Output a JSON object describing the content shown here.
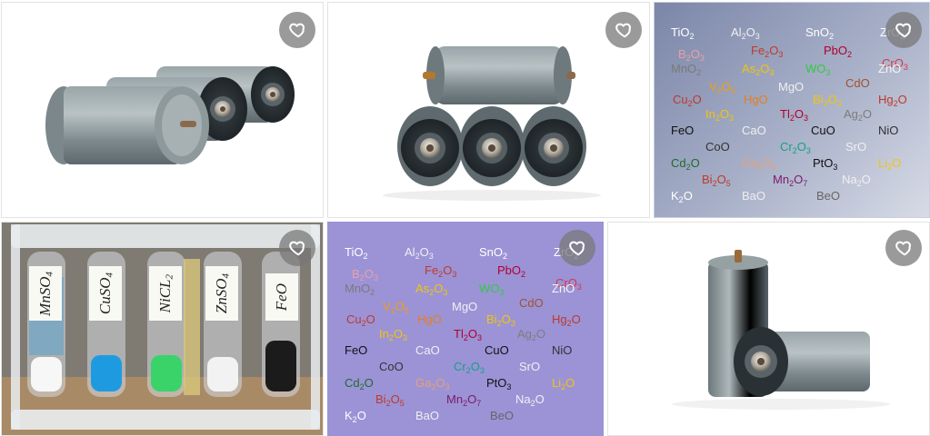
{
  "gallery": {
    "tiles": [
      {
        "alt": "three gray cylindrical battery cells lying on their side",
        "fav": "favorite"
      },
      {
        "alt": "gray battery cells stacked in a pyramid",
        "fav": "favorite"
      },
      {
        "alt": "metal oxides formulas chart",
        "fav": "favorite",
        "style": "gray-blue"
      },
      {
        "alt": "test tubes with salts",
        "fav": "favorite"
      },
      {
        "alt": "metal oxides formulas chart",
        "fav": "favorite",
        "style": "lavender"
      },
      {
        "alt": "two gray battery cells, one standing",
        "fav": "favorite"
      }
    ]
  },
  "oxides": [
    {
      "t": "TiO",
      "s": "2",
      "c": "#ffffff"
    },
    {
      "t": "Al",
      "s": "2",
      "t2": "O",
      "s2": "3",
      "c": "#f0f0f0"
    },
    {
      "t": "SnO",
      "s": "2",
      "c": "#ffffff"
    },
    {
      "t": "ZrO",
      "s": "2",
      "c": "#ffffff"
    },
    {
      "t": "B",
      "s": "2",
      "t2": "O",
      "s2": "3",
      "c": "#e9a0a8"
    },
    {
      "t": "Fe",
      "s": "2",
      "t2": "O",
      "s2": "3",
      "c": "#c0392b"
    },
    {
      "t": "PbO",
      "s": "2",
      "c": "#b3002d"
    },
    {
      "t": "CrO",
      "s": "3",
      "c": "#d9364c"
    },
    {
      "t": "MnO",
      "s": "2",
      "c": "#7a7a7a"
    },
    {
      "t": "As",
      "s": "2",
      "t2": "O",
      "s2": "3",
      "c": "#f1c40f"
    },
    {
      "t": "WO",
      "s": "3",
      "c": "#2ecc40"
    },
    {
      "t": "ZnO",
      "s": "",
      "c": "#f5f5f5"
    },
    {
      "t": "V",
      "s": "2",
      "t2": "O",
      "s2": "5",
      "c": "#f39c12"
    },
    {
      "t": "MgO",
      "s": "",
      "c": "#f0f0f0"
    },
    {
      "t": "CdO",
      "s": "",
      "c": "#a0522d"
    },
    {
      "t": "Cu",
      "s": "2",
      "t2": "O",
      "s2": "",
      "c": "#c0392b"
    },
    {
      "t": "HgO",
      "s": "",
      "c": "#e67e22"
    },
    {
      "t": "Bi",
      "s": "2",
      "t2": "O",
      "s2": "3",
      "c": "#f1c40f"
    },
    {
      "t": "Hg",
      "s": "2",
      "t2": "O",
      "s2": "",
      "c": "#c0392b"
    },
    {
      "t": "In",
      "s": "2",
      "t2": "O",
      "s2": "3",
      "c": "#f1c40f"
    },
    {
      "t": "Tl",
      "s": "2",
      "t2": "O",
      "s2": "3",
      "c": "#b3002d"
    },
    {
      "t": "Ag",
      "s": "2",
      "t2": "O",
      "s2": "",
      "c": "#7d7d7d"
    },
    {
      "t": "FeO",
      "s": "",
      "c": "#111111"
    },
    {
      "t": "CaO",
      "s": "",
      "c": "#f0f0f0"
    },
    {
      "t": "CuO",
      "s": "",
      "c": "#111111"
    },
    {
      "t": "NiO",
      "s": "",
      "c": "#333333"
    },
    {
      "t": "CoO",
      "s": "",
      "c": "#333333"
    },
    {
      "t": "Cr",
      "s": "2",
      "t2": "O",
      "s2": "3",
      "c": "#16a085"
    },
    {
      "t": "SrO",
      "s": "",
      "c": "#f0f0f0"
    },
    {
      "t": "Cd",
      "s": "2",
      "t2": "O",
      "s2": "",
      "c": "#1e6b2c"
    },
    {
      "t": "Ga",
      "s": "2",
      "t2": "O",
      "s2": "3",
      "c": "#e6a07a"
    },
    {
      "t": "PtO",
      "s": "3",
      "c": "#111111"
    },
    {
      "t": "Li",
      "s": "2",
      "t2": "O",
      "s2": "",
      "c": "#f1c40f"
    },
    {
      "t": "Bi",
      "s": "2",
      "t2": "O",
      "s2": "5",
      "c": "#c0392b"
    },
    {
      "t": "Mn",
      "s": "2",
      "t2": "O",
      "s2": "7",
      "c": "#7d1a6b"
    },
    {
      "t": "Na",
      "s": "2",
      "t2": "O",
      "s2": "",
      "c": "#f0f0f0"
    },
    {
      "t": "K",
      "s": "2",
      "t2": "O",
      "s2": "",
      "c": "#ffffff"
    },
    {
      "t": "BaO",
      "s": "",
      "c": "#eeeeee"
    },
    {
      "t": "BeO",
      "s": "",
      "c": "#666666"
    }
  ],
  "tube_labels": [
    "MnSO4",
    "CuSO4",
    "NiCL2",
    "ZnSO4",
    "FeO"
  ],
  "colors": {
    "tile3_bg": "#8e98b8",
    "tile5_bg": "#9b93d6",
    "fav_bg": "#7a7a7a"
  }
}
